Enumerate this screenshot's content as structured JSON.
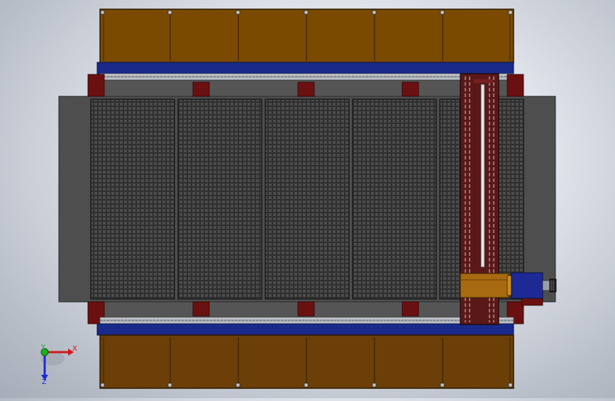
{
  "viewport": {
    "view_orientation": "top",
    "triad_axes": {
      "x_label": "X",
      "y_label": "Y",
      "z_label": "Z"
    }
  },
  "model": {
    "table_panels": 5,
    "colors": {
      "wood_top": "#7a4a00",
      "wood_bottom": "#6b3f07",
      "blue_rail": "#1a2a8a",
      "red_bracket": "#6b1010",
      "grating": "#3d3d3d",
      "frame": "#4e4e4e",
      "gantry": "#5b1818",
      "head_blue": "#1d2a96",
      "head_orange": "#a86a10"
    }
  }
}
